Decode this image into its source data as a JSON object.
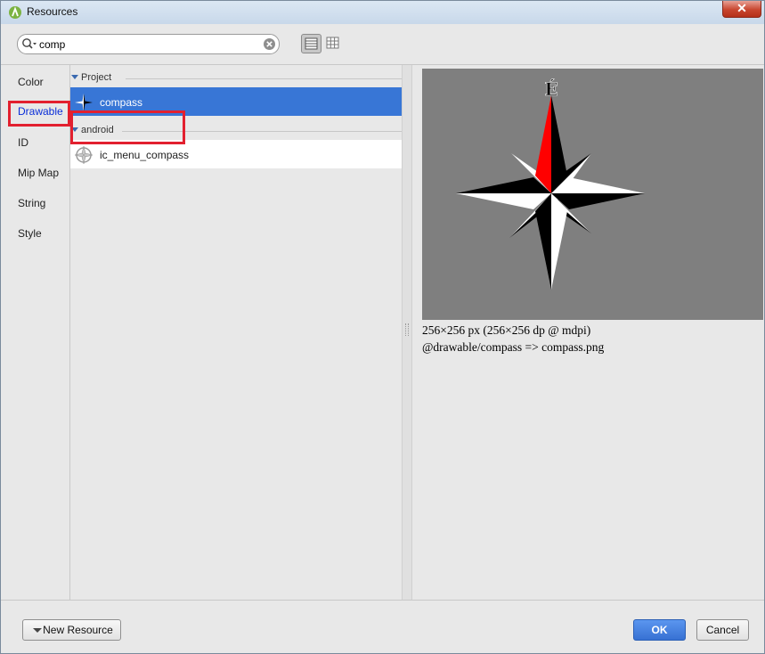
{
  "window": {
    "title": "Resources",
    "close_glyph": "✕"
  },
  "search": {
    "value": "comp",
    "placeholder": ""
  },
  "resource_types": [
    {
      "label": "Color",
      "selected": false
    },
    {
      "label": "Drawable",
      "selected": true
    },
    {
      "label": "ID",
      "selected": false
    },
    {
      "label": "Mip Map",
      "selected": false
    },
    {
      "label": "String",
      "selected": false
    },
    {
      "label": "Style",
      "selected": false
    }
  ],
  "groups": [
    {
      "label": "Project",
      "items": [
        {
          "label": "compass",
          "icon": "compass-rose-icon",
          "selected": true
        }
      ]
    },
    {
      "label": "android",
      "items": [
        {
          "label": "ic_menu_compass",
          "icon": "menu-compass-icon",
          "selected": false
        }
      ]
    }
  ],
  "preview": {
    "compass_letter": "É",
    "size_info": "256×256 px (256×256 dp @ mdpi)",
    "path_info": "@drawable/compass => compass.png"
  },
  "buttons": {
    "new_resource": "New Resource",
    "ok": "OK",
    "cancel": "Cancel"
  },
  "colors": {
    "selection": "#3876d6",
    "highlight_box": "#e2202f",
    "ok_button": "#3771d3",
    "preview_bg": "#7f7f7f"
  }
}
